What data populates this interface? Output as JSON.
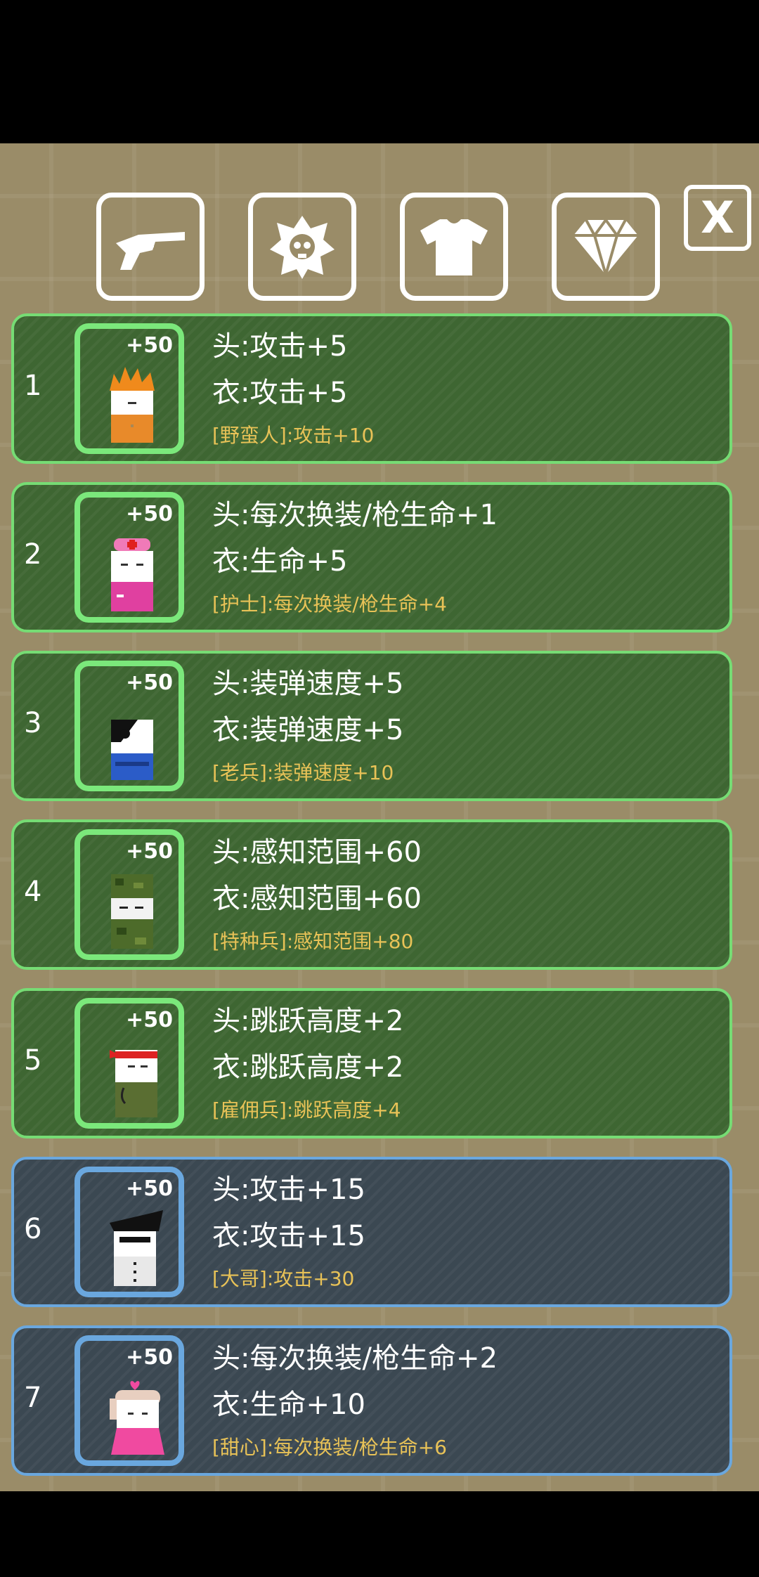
{
  "tabs": [
    {
      "icon": "revolver-icon"
    },
    {
      "icon": "skull-badge-icon"
    },
    {
      "icon": "shirt-icon"
    },
    {
      "icon": "diamond-icon"
    }
  ],
  "close_label": "X",
  "rows": [
    {
      "index": "1",
      "bonus": "+50",
      "head": "头:攻击+5",
      "body": "衣:攻击+5",
      "set": "[野蛮人]:攻击+10",
      "tier": "green"
    },
    {
      "index": "2",
      "bonus": "+50",
      "head": "头:每次换装/枪生命+1",
      "body": "衣:生命+5",
      "set": "[护士]:每次换装/枪生命+4",
      "tier": "green"
    },
    {
      "index": "3",
      "bonus": "+50",
      "head": "头:装弹速度+5",
      "body": "衣:装弹速度+5",
      "set": "[老兵]:装弹速度+10",
      "tier": "green"
    },
    {
      "index": "4",
      "bonus": "+50",
      "head": "头:感知范围+60",
      "body": "衣:感知范围+60",
      "set": "[特种兵]:感知范围+80",
      "tier": "green"
    },
    {
      "index": "5",
      "bonus": "+50",
      "head": "头:跳跃高度+2",
      "body": "衣:跳跃高度+2",
      "set": "[雇佣兵]:跳跃高度+4",
      "tier": "green"
    },
    {
      "index": "6",
      "bonus": "+50",
      "head": "头:攻击+15",
      "body": "衣:攻击+15",
      "set": "[大哥]:攻击+30",
      "tier": "blue"
    },
    {
      "index": "7",
      "bonus": "+50",
      "head": "头:每次换装/枪生命+2",
      "body": "衣:生命+10",
      "set": "[甜心]:每次换装/枪生命+6",
      "tier": "blue"
    }
  ],
  "colors": {
    "green_border": "#76dc74",
    "blue_border": "#6aa7de",
    "set_text": "#e8c257"
  }
}
